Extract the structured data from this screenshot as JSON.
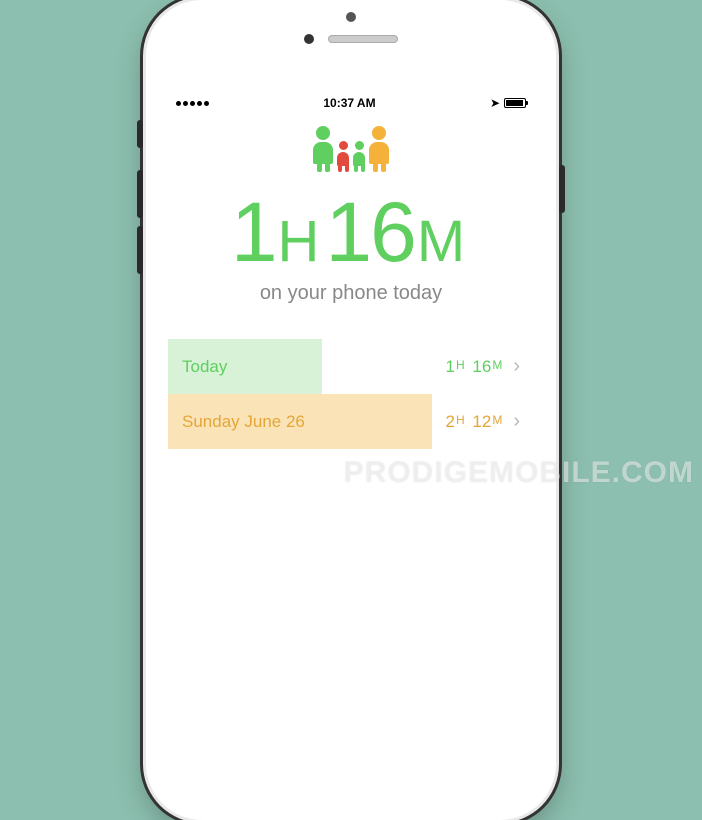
{
  "statusbar": {
    "signal_dots": 5,
    "time": "10:37 AM",
    "location_glyph": "➤"
  },
  "hero": {
    "time_display": "1H 16M",
    "hours": "1",
    "hours_unit": "H",
    "minutes": "16",
    "minutes_unit": "M",
    "subtitle": "on your phone today"
  },
  "history": [
    {
      "label": "Today",
      "value_hours": "1",
      "value_minutes": "16",
      "color": "green",
      "bar_pct": 42
    },
    {
      "label": "Sunday June 26",
      "value_hours": "2",
      "value_minutes": "12",
      "color": "orange",
      "bar_pct": 72
    }
  ],
  "watermark": "PRODIGEMOBILE.COM",
  "icons": {
    "family": "family-icon",
    "location": "location-arrow-icon",
    "chevron": "chevron-right-icon",
    "battery": "battery-icon",
    "signal": "signal-dots-icon"
  }
}
